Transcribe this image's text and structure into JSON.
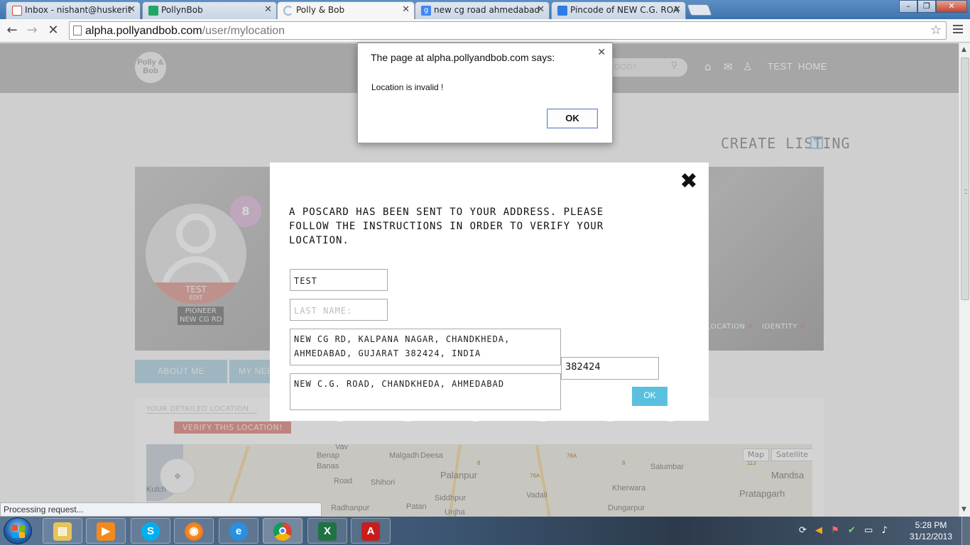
{
  "browser": {
    "tabs": [
      {
        "label": "Inbox - nishant@huskerit",
        "color": "#d44638"
      },
      {
        "label": "PollynBob",
        "color": "#23a566"
      },
      {
        "label": "Polly & Bob",
        "color": "#9fb8d6"
      },
      {
        "label": "new cg road ahmedabad",
        "color": "#4285f4"
      },
      {
        "label": "Pincode of NEW C.G. ROA",
        "color": "#2f7ce3"
      }
    ],
    "url_domain": "alpha.pollyandbob.com",
    "url_path": "/user/mylocation",
    "status": "Processing request..."
  },
  "site": {
    "logo": "Polly & Bob",
    "search_placeholder": "OOD?",
    "nav": {
      "user": "TEST",
      "home": "HOME"
    },
    "create_listing": "CREATE LISTING",
    "profile": {
      "name": "TEST",
      "edit": "EDIT",
      "badge_count": "8",
      "rank": "PIONEER",
      "area": "NEW CG RD",
      "verifications": [
        "LOCATION",
        "IDENTITY"
      ]
    },
    "tabs": [
      "ABOUT ME",
      "MY NEI"
    ],
    "location": {
      "label": "YOUR DETAILED LOCATION",
      "verify": "VERIFY THIS LOCATION!"
    },
    "map": {
      "type_buttons": [
        "Map",
        "Satellite"
      ],
      "places": [
        "Vav",
        "Malgadh",
        "Deesa",
        "Banas",
        "Palanpur",
        "Salumbar",
        "Mandsa",
        "Benap",
        "Shihori",
        "Road",
        "Siddhpur",
        "Vadali",
        "Kherwara",
        "Pratapgarh",
        "Kutch",
        "Radhanpur",
        "Patan",
        "Unjha",
        "Dungarpur"
      ],
      "shields": [
        "76A",
        "8",
        "76A",
        "113",
        "8"
      ]
    }
  },
  "modal": {
    "message": "A POSCARD HAS BEEN SENT TO YOUR ADDRESS. PLEASE FOLLOW THE INSTRUCTIONS IN ORDER TO VERIFY YOUR LOCATION.",
    "first_name": "TEST",
    "last_name_placeholder": "LAST NAME:",
    "address_line1": "NEW CG RD, KALPANA NAGAR, CHANDKHEDA, AHMEDABAD, GUJARAT 382424, INDIA",
    "address_line2": "NEW C.G. ROAD, CHANDKHEDA, AHMEDABAD",
    "pincode": "382424",
    "ok": "OK"
  },
  "alert": {
    "title": "The page at alpha.pollyandbob.com says:",
    "message": "Location is invalid !",
    "ok": "OK"
  },
  "taskbar": {
    "apps": [
      "Windows Explorer",
      "Media Player",
      "Skype",
      "Firefox",
      "Internet Explorer",
      "Chrome",
      "Excel",
      "Adobe Reader"
    ],
    "time": "5:28 PM",
    "date": "31/12/2013"
  }
}
